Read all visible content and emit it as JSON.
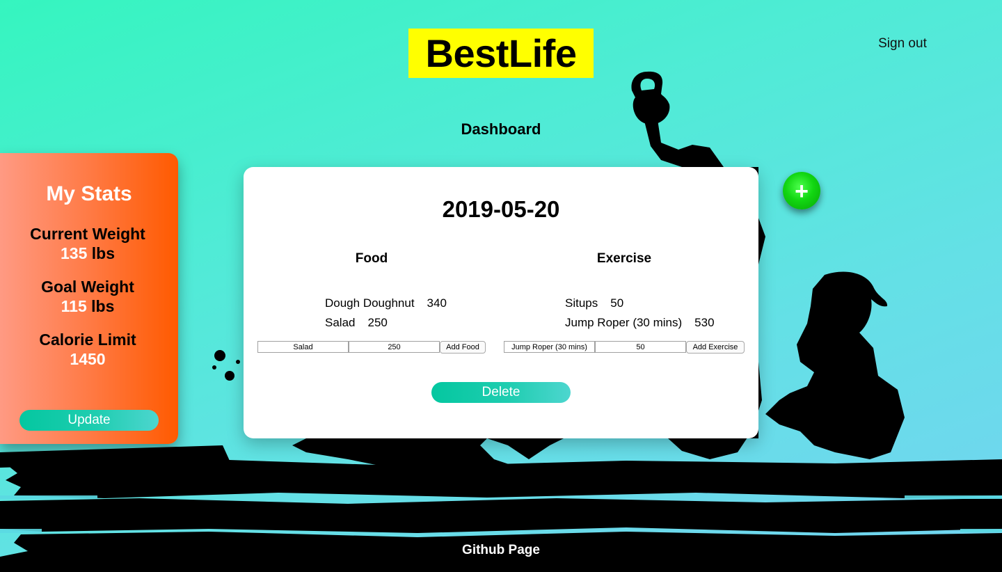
{
  "header": {
    "logo": "BestLife",
    "signout_label": "Sign out",
    "page_title": "Dashboard"
  },
  "stats": {
    "title": "My Stats",
    "current_weight_label": "Current Weight",
    "current_weight_value": "135",
    "goal_weight_label": "Goal Weight",
    "goal_weight_value": "115",
    "weight_unit": "lbs",
    "calorie_limit_label": "Calorie Limit",
    "calorie_limit_value": "1450",
    "update_label": "Update"
  },
  "day": {
    "date": "2019-05-20",
    "food_heading": "Food",
    "exercise_heading": "Exercise",
    "food_items": [
      {
        "name": "Dough Doughnut",
        "value": "340"
      },
      {
        "name": "Salad",
        "value": "250"
      }
    ],
    "exercise_items": [
      {
        "name": "Situps",
        "value": "50"
      },
      {
        "name": "Jump Roper (30 mins)",
        "value": "530"
      }
    ],
    "food_form": {
      "name_value": "Salad",
      "calories_value": "250",
      "add_label": "Add Food"
    },
    "exercise_form": {
      "name_value": "Jump Roper (30 mins)",
      "calories_value": "50",
      "add_label": "Add Exercise"
    },
    "delete_label": "Delete"
  },
  "fab": {
    "icon": "plus-icon",
    "glyph": "+"
  },
  "footer": {
    "github_label": "Github Page"
  },
  "colors": {
    "logo_bg": "#ffff00",
    "stats_panel": "#ff5a00",
    "button_teal": "#04c7a0",
    "fab_green": "#12d612",
    "silhouette": "#000000"
  }
}
